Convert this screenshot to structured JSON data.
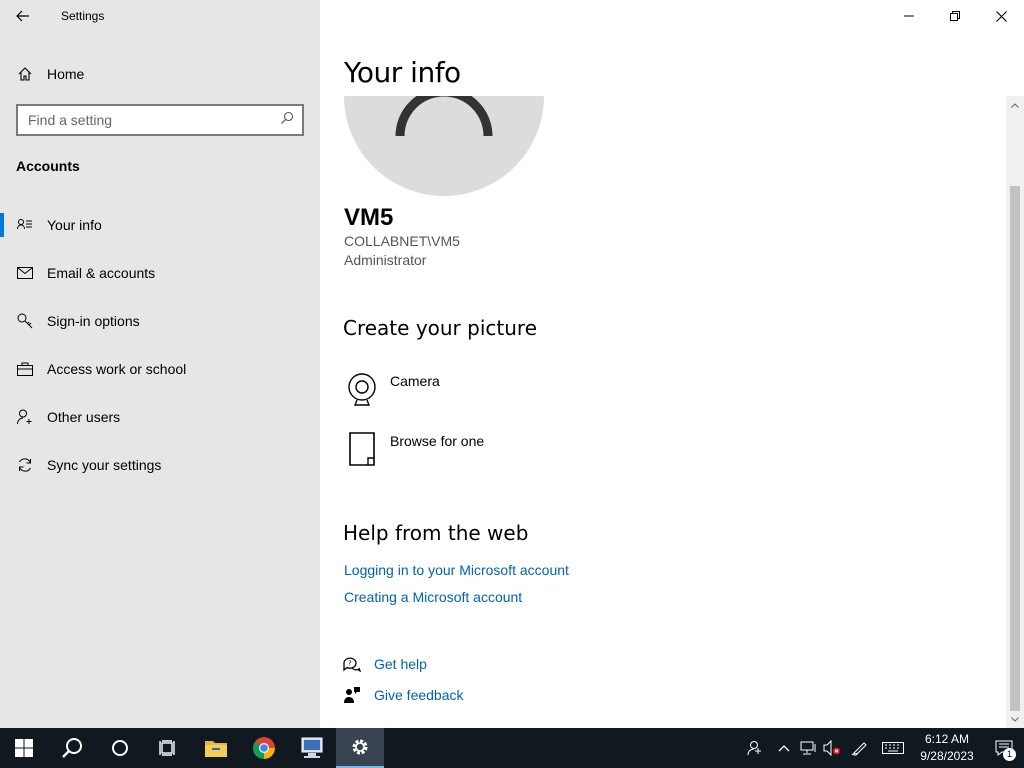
{
  "window": {
    "title": "Settings"
  },
  "sidebar": {
    "home_label": "Home",
    "search_placeholder": "Find a setting",
    "section": "Accounts",
    "items": [
      {
        "label": "Your info",
        "icon": "user-card-icon",
        "active": true
      },
      {
        "label": "Email & accounts",
        "icon": "mail-icon"
      },
      {
        "label": "Sign-in options",
        "icon": "key-icon"
      },
      {
        "label": "Access work or school",
        "icon": "briefcase-icon"
      },
      {
        "label": "Other users",
        "icon": "add-user-icon"
      },
      {
        "label": "Sync your settings",
        "icon": "sync-icon"
      }
    ]
  },
  "main": {
    "title": "Your info",
    "user": {
      "name": "VM5",
      "domain": "COLLABNET\\VM5",
      "role": "Administrator"
    },
    "create_picture": {
      "heading": "Create your picture",
      "options": [
        {
          "label": "Camera",
          "icon": "camera-icon"
        },
        {
          "label": "Browse for one",
          "icon": "file-icon"
        }
      ]
    },
    "help": {
      "heading": "Help from the web",
      "links": [
        "Logging in to your Microsoft account",
        "Creating a Microsoft account"
      ]
    },
    "support": [
      {
        "label": "Get help",
        "icon": "help-chat-icon"
      },
      {
        "label": "Give feedback",
        "icon": "feedback-icon"
      }
    ]
  },
  "taskbar": {
    "clock_time": "6:12 AM",
    "clock_date": "9/28/2023",
    "notification_count": "1"
  },
  "colors": {
    "accent": "#0078d7",
    "link": "#0063b1",
    "taskbar": "#101820",
    "sidebar": "#e6e6e6"
  }
}
